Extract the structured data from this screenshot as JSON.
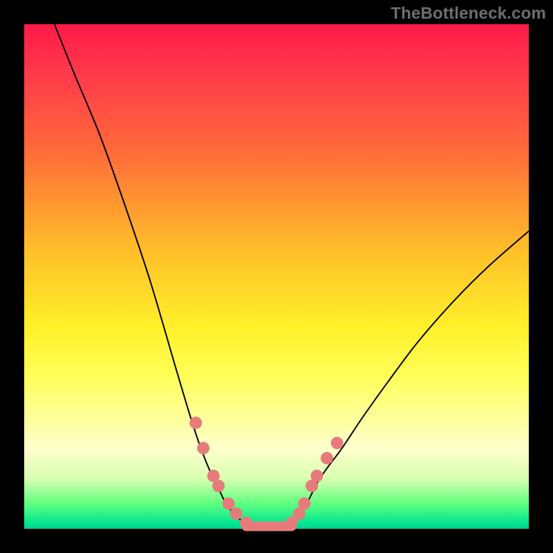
{
  "watermark": "TheBottleneck.com",
  "colors": {
    "background": "#000000",
    "gradient_top": "#ff1a4a",
    "gradient_mid": "#fff02a",
    "gradient_bottom": "#00d090",
    "curve": "#000000",
    "marker": "#e77b7b"
  },
  "chart_data": {
    "type": "line",
    "title": "",
    "xlabel": "",
    "ylabel": "",
    "xlim": [
      0,
      100
    ],
    "ylim": [
      0,
      100
    ],
    "series": [
      {
        "name": "left-curve",
        "x": [
          6,
          10,
          15,
          20,
          25,
          30,
          33,
          35,
          37,
          38.5,
          40,
          42,
          44,
          45
        ],
        "y": [
          100,
          90,
          78,
          64,
          49,
          32,
          22,
          16,
          11,
          8,
          5,
          2.5,
          1,
          0.5
        ]
      },
      {
        "name": "right-curve",
        "x": [
          52,
          54,
          56,
          58,
          60,
          63,
          67,
          72,
          78,
          85,
          92,
          100
        ],
        "y": [
          0.5,
          2,
          5,
          9,
          12,
          16,
          22,
          29,
          37,
          45,
          52,
          59
        ]
      },
      {
        "name": "flat-bottom-segment",
        "x": [
          44,
          53
        ],
        "y": [
          0.5,
          0.5
        ]
      }
    ],
    "markers": {
      "left": [
        {
          "x": 34,
          "y": 21
        },
        {
          "x": 35.5,
          "y": 16
        },
        {
          "x": 37.5,
          "y": 10.5
        },
        {
          "x": 38.5,
          "y": 8.5
        },
        {
          "x": 40.5,
          "y": 5
        },
        {
          "x": 42,
          "y": 3
        },
        {
          "x": 44,
          "y": 1.2
        }
      ],
      "right": [
        {
          "x": 53,
          "y": 1.2
        },
        {
          "x": 54.5,
          "y": 3
        },
        {
          "x": 55.5,
          "y": 5
        },
        {
          "x": 57,
          "y": 8.5
        },
        {
          "x": 58,
          "y": 10.5
        },
        {
          "x": 60,
          "y": 14
        },
        {
          "x": 62,
          "y": 17
        }
      ]
    }
  }
}
